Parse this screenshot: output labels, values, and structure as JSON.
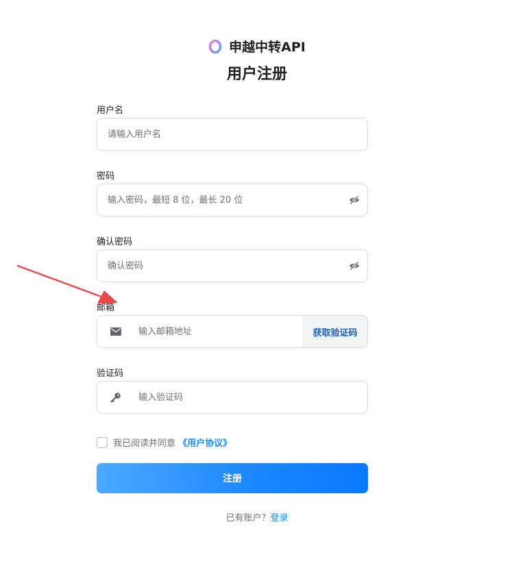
{
  "brand": {
    "name": "申越中转API"
  },
  "page_title": "用户注册",
  "fields": {
    "username": {
      "label": "用户名",
      "placeholder": "请输入用户名",
      "value": ""
    },
    "password": {
      "label": "密码",
      "placeholder": "输入密码，最短 8 位，最长 20 位",
      "value": ""
    },
    "confirm": {
      "label": "确认密码",
      "placeholder": "确认密码",
      "value": ""
    },
    "email": {
      "label": "邮箱",
      "placeholder": "输入邮箱地址",
      "value": "",
      "button": "获取验证码"
    },
    "code": {
      "label": "验证码",
      "placeholder": "输入验证码",
      "value": ""
    }
  },
  "agreement": {
    "text": "我已阅读并同意",
    "link": "《用户协议》",
    "checked": false
  },
  "submit_label": "注册",
  "login": {
    "question": "已有账户？",
    "link": "登录"
  },
  "icons": {
    "logo": "brand-ring-icon",
    "eye": "eye-off-icon",
    "mail": "mail-icon",
    "key": "key-icon"
  },
  "colors": {
    "accent": "#1a86ff",
    "link": "#1a8dff",
    "code_button_text": "#1a5fbf",
    "annotation_arrow": "#e8474b"
  }
}
